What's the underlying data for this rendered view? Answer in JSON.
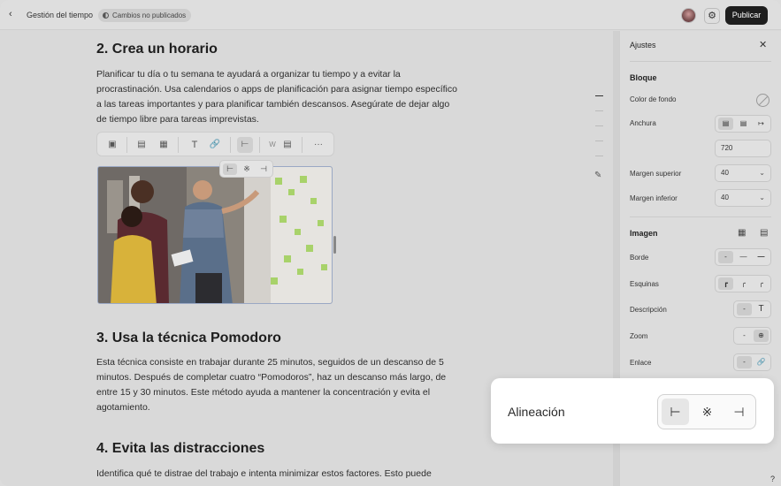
{
  "topbar": {
    "back_icon": "chevron-left-icon",
    "title": "Gestión del tiempo",
    "status_badge": "Cambios no publicados",
    "publish_label": "Publicar"
  },
  "content": {
    "section2_title": "2. Crea un horario",
    "section2_text": "Planificar tu día o tu semana te ayudará a organizar tu tiempo y a evitar la procrastinación. Usa calendarios o apps de planificación para asignar tiempo específico a las tareas importantes y para planificar también descansos. Asegúrate de dejar algo de tiempo libre para tareas imprevistas.",
    "section3_title": "3. Usa la técnica Pomodoro",
    "section3_text": "Esta técnica consiste en trabajar durante 25 minutos, seguidos de un descanso de 5 minutos. Después de completar cuatro “Pomodoros”, haz un descanso más largo, de entre 15 y 30 minutos. Este método ayuda a mantener la concentración y evita el agotamiento.",
    "section4_title": "4. Evita las distracciones",
    "section4_text": "Identifica qué te distrae del trabajo e intenta minimizar estos factores. Esto puede"
  },
  "toolbar": {
    "text_glyph": "T",
    "width_glyph": "W",
    "more_glyph": "···"
  },
  "panel": {
    "title": "Ajustes",
    "block_section": "Bloque",
    "bg_color_label": "Color de fondo",
    "width_label": "Anchura",
    "width_value": "720",
    "margin_top_label": "Margen superior",
    "margin_top_value": "40",
    "margin_bottom_label": "Margen inferior",
    "margin_bottom_value": "40",
    "image_section": "Imagen",
    "border_label": "Borde",
    "corners_label": "Esquinas",
    "description_label": "Descripción",
    "zoom_label": "Zoom",
    "link_label": "Enlace",
    "dash": "-",
    "text_glyph": "T"
  },
  "callout": {
    "label": "Alineación",
    "selected": "left"
  },
  "help": "?",
  "colors": {
    "publish_bg": "#1e1e1e",
    "image_border": "#9aa8c4",
    "sticky_note": "#a8d26a"
  }
}
